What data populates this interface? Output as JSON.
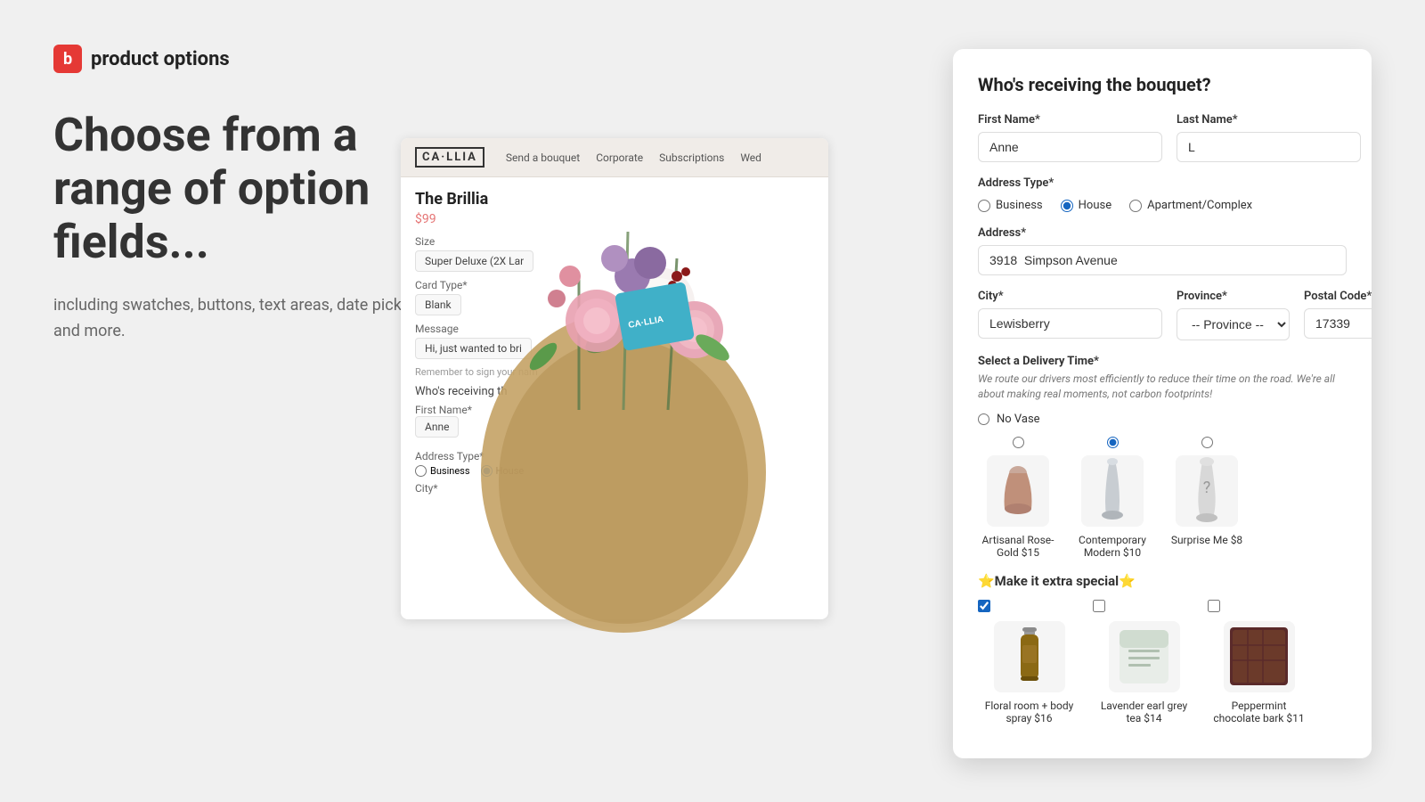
{
  "app": {
    "logo_letter": "b",
    "logo_text": "product options"
  },
  "left": {
    "headline": "Choose from a range of option fields...",
    "subtext": "including swatches, buttons, text areas, date pickers, and more."
  },
  "store": {
    "logo": "CA LLIA",
    "nav": [
      "Send a bouquet",
      "Corporate",
      "Subscriptions",
      "Wed"
    ],
    "product_title": "The Brillia",
    "price": "$99",
    "size_label": "Size",
    "size_value": "Super Deluxe (2X Lar",
    "card_label": "Card Type*",
    "card_value": "Blank",
    "message_label": "Message",
    "message_value": "Hi, just wanted to bri",
    "sign_reminder": "Remember to sign your nam",
    "who_label": "Who's receiving th",
    "first_name_label": "First Name*",
    "first_name_value": "Anne",
    "address_label": "Address Type*",
    "city_label": "City*",
    "address_options": [
      "Business",
      "House"
    ]
  },
  "form": {
    "title": "Who's receiving the bouquet?",
    "first_name_label": "First Name*",
    "first_name_value": "Anne",
    "last_name_label": "Last Name*",
    "last_name_value": "L",
    "address_type_label": "Address Type*",
    "address_options": [
      {
        "value": "business",
        "label": "Business",
        "checked": false
      },
      {
        "value": "house",
        "label": "House",
        "checked": true
      },
      {
        "value": "apartment",
        "label": "Apartment/Complex",
        "checked": false
      }
    ],
    "address_label": "Address*",
    "address_value": "3918  Simpson Avenue",
    "city_label": "City*",
    "city_value": "Lewisberry",
    "province_label": "Province*",
    "province_value": "-- Province --",
    "postal_label": "Postal Code*",
    "postal_value": "17339",
    "delivery_title": "Select a Delivery Time*",
    "delivery_subtitle": "We route our drivers most efficiently to reduce their time on the road. We're all about making real moments, not carbon footprints!",
    "no_vase_label": "No Vase",
    "vases": [
      {
        "id": "artisanal",
        "label": "Artisanal Rose-Gold $15",
        "selected": false
      },
      {
        "id": "contemporary",
        "label": "Contemporary Modern $10",
        "selected": true
      },
      {
        "id": "surprise",
        "label": "Surprise Me $8",
        "selected": false
      }
    ],
    "special_title": "⭐Make it extra special⭐",
    "addons": [
      {
        "id": "floral",
        "label": "Floral room + body spray $16",
        "checked": true
      },
      {
        "id": "lavender",
        "label": "Lavender earl grey tea $14",
        "checked": false
      },
      {
        "id": "peppermint",
        "label": "Peppermint chocolate bark $11",
        "checked": false
      }
    ]
  }
}
